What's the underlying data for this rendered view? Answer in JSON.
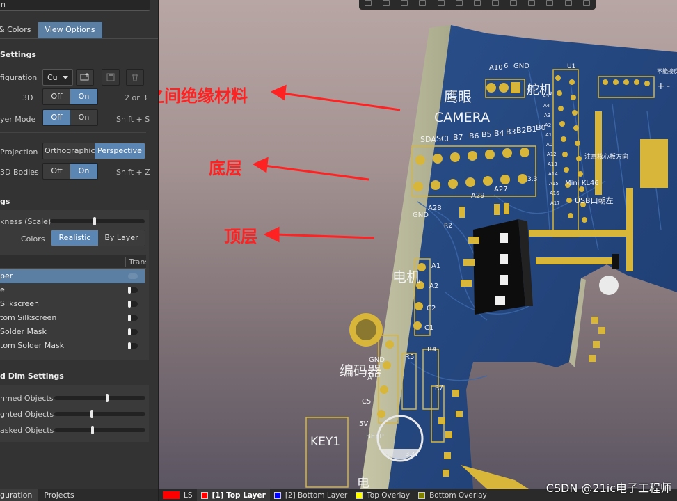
{
  "panel": {
    "search_text": "n",
    "tabs": [
      "& Colors",
      "View Options"
    ],
    "general": {
      "title": "Settings",
      "configuration": {
        "label": "figuration",
        "value": "Cu"
      },
      "three_d": {
        "label": "3D",
        "off": "Off",
        "on": "On",
        "hint": "2 or 3"
      },
      "single_layer": {
        "label": "yer Mode",
        "off": "Off",
        "on": "On",
        "hint": "Shift + S"
      },
      "projection": {
        "label": "Projection",
        "ortho": "Orthographic",
        "persp": "Perspective"
      },
      "bodies": {
        "label": "3D Bodies",
        "off": "Off",
        "on": "On",
        "hint": "Shift + Z"
      }
    },
    "materials": {
      "title": "gs",
      "thickness_label": "kness (Scale)",
      "thickness_value": 0.47,
      "colors_label": "Colors",
      "realistic": "Realistic",
      "by_layer": "By Layer",
      "trans_header": "Trans",
      "layers": [
        "per",
        "e",
        " Silkscreen",
        "tom Silkscreen",
        " Solder Mask",
        "tom Solder Mask"
      ]
    },
    "dim": {
      "title": "d Dim Settings",
      "rows": [
        {
          "label": "nmed Objects",
          "value": 0.58
        },
        {
          "label": "ghted Objects",
          "value": 0.41
        },
        {
          "label": "asked Objects",
          "value": 0.42
        }
      ]
    },
    "bottom_tabs": [
      "guration",
      "Projects"
    ]
  },
  "annotations": {
    "insulation": "之间绝缘材料",
    "bottom_layer": "底层",
    "top_layer": "顶层"
  },
  "silkscreen": {
    "pins_top": [
      "A10",
      "6",
      "GND"
    ],
    "servo": "舵机",
    "eagle": "鹰眼",
    "camera": "CAMERA",
    "cam_pins": [
      "SDA",
      "SCL",
      "B7",
      "B6",
      "B5",
      "B4",
      "B3",
      "B2",
      "B1",
      "B0"
    ],
    "gnd_a28": [
      "GND",
      "A28"
    ],
    "a29": "A29",
    "a27": "A27",
    "v33": "3.3",
    "motor": "电机",
    "motor_pins": [
      "A1",
      "A2",
      "C2",
      "C1"
    ],
    "encoder": "编码器",
    "enc_pins": [
      "GND",
      "A",
      "C5",
      "5V"
    ],
    "r5": "R5",
    "r4": "R4",
    "r2": "R2",
    "r7": "R7",
    "beep": "BEEP",
    "key1": "KEY1",
    "u1": "U1",
    "usb": "USB口朝左",
    "mini": "Mini KL46",
    "notice": "注意核心板方向",
    "right_pins": [
      "A5",
      "A4",
      "A3",
      "A2",
      "A1",
      "A0",
      "A12",
      "A13",
      "A14",
      "A15",
      "A16",
      "A17"
    ],
    "plus": "+",
    "minus": "-",
    "corner_text": "不能接反",
    "sv": "3.3V",
    "partial_motor2": "电"
  },
  "status": {
    "ls": "LS",
    "layers": [
      {
        "name": "[1] Top Layer",
        "color": "#ff0000"
      },
      {
        "name": "[2] Bottom Layer",
        "color": "#0000ff"
      },
      {
        "name": "Top Overlay",
        "color": "#ffff00"
      },
      {
        "name": "Bottom Overlay",
        "color": "#808000"
      }
    ]
  },
  "watermark": "CSDN @21ic电子工程师"
}
